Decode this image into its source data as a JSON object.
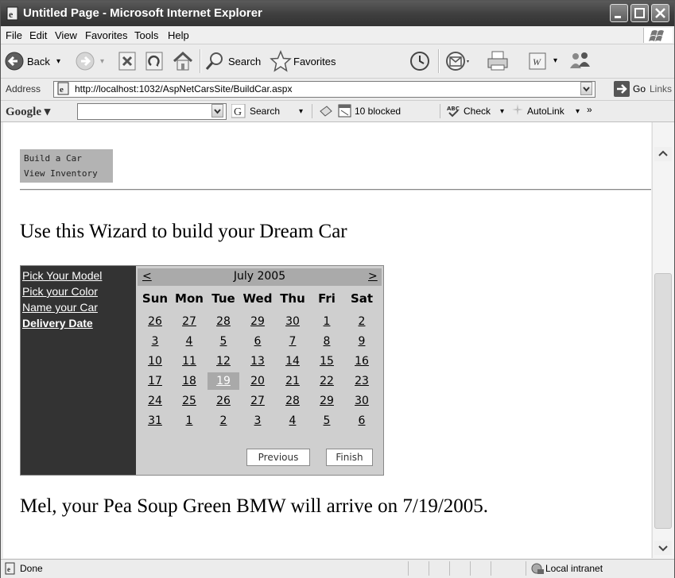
{
  "window": {
    "title": "Untitled Page - Microsoft Internet Explorer"
  },
  "menu": [
    "File",
    "Edit",
    "View",
    "Favorites",
    "Tools",
    "Help"
  ],
  "toolbar": {
    "back": "Back",
    "search": "Search",
    "favorites": "Favorites"
  },
  "address": {
    "label": "Address",
    "url": "http://localhost:1032/AspNetCarsSite/BuildCar.aspx",
    "go": "Go",
    "links": "Links"
  },
  "google": {
    "logo": "Google",
    "search": "Search",
    "blocked": "10 blocked",
    "check": "Check",
    "autolink": "AutoLink",
    "more": "»"
  },
  "site_menu": [
    "Build a Car",
    "View Inventory"
  ],
  "heading": "Use this Wizard to build your Dream Car",
  "wizard": {
    "steps": [
      {
        "label": "Pick Your Model",
        "active": false
      },
      {
        "label": "Pick your Color",
        "active": false
      },
      {
        "label": "Name your Car",
        "active": false
      },
      {
        "label": "Delivery Date",
        "active": true
      }
    ],
    "calendar": {
      "title": "July 2005",
      "prev": "<",
      "next": ">",
      "days_of_week": [
        "Sun",
        "Mon",
        "Tue",
        "Wed",
        "Thu",
        "Fri",
        "Sat"
      ],
      "weeks": [
        [
          "26",
          "27",
          "28",
          "29",
          "30",
          "1",
          "2"
        ],
        [
          "3",
          "4",
          "5",
          "6",
          "7",
          "8",
          "9"
        ],
        [
          "10",
          "11",
          "12",
          "13",
          "14",
          "15",
          "16"
        ],
        [
          "17",
          "18",
          "19",
          "20",
          "21",
          "22",
          "23"
        ],
        [
          "24",
          "25",
          "26",
          "27",
          "28",
          "29",
          "30"
        ],
        [
          "31",
          "1",
          "2",
          "3",
          "4",
          "5",
          "6"
        ]
      ],
      "selected": "19"
    },
    "buttons": {
      "previous": "Previous",
      "finish": "Finish"
    }
  },
  "result": "Mel, your Pea Soup Green BMW will arrive on 7/19/2005.",
  "status": {
    "text": "Done",
    "zone": "Local intranet"
  }
}
